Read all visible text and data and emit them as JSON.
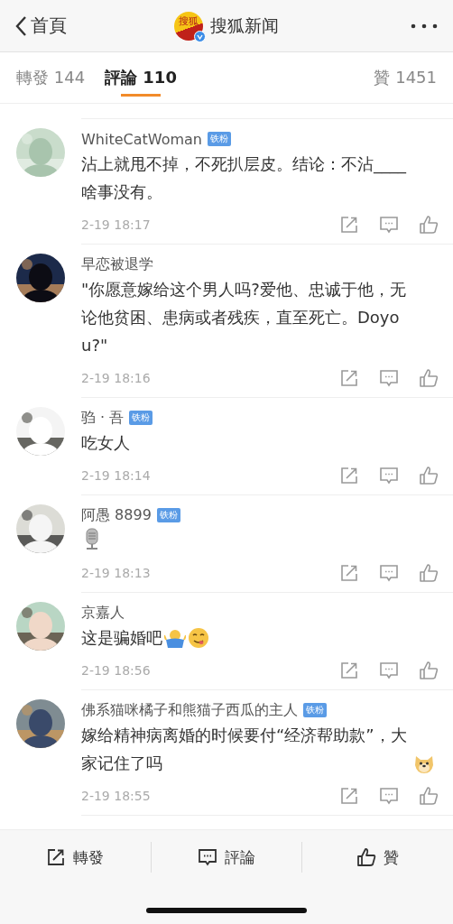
{
  "nav": {
    "back": "首頁",
    "logo_text": "搜狐",
    "verified": true,
    "title": "搜狐新闻"
  },
  "tabs": [
    {
      "label": "轉發 144",
      "selected": false
    },
    {
      "label": "評論 110",
      "selected": true
    },
    {
      "label": "贊 1451",
      "selected": false
    }
  ],
  "comments": [
    {
      "name": "WhiteCatWoman",
      "badge": "铁粉",
      "text": "沾上就甩不掉，不死扒层皮。结论：不沾____啥事没有。",
      "time": "2-19 18:17"
    },
    {
      "name": "早恋被退学",
      "text": "\"你愿意嫁给这个男人吗?爱他、忠诚于他，无论他贫困、患病或者残疾，直至死亡。Doyou?\"",
      "time": "2-19 18:16"
    },
    {
      "name": "驺 · 吾",
      "badge": "铁粉",
      "text": "吃女人",
      "time": "2-19 18:14"
    },
    {
      "name": "阿愚 8899",
      "badge": "铁粉",
      "emojis": [
        {
          "kind": "microphone"
        }
      ],
      "time": "2-19 18:13"
    },
    {
      "name": "京嘉人",
      "text": "这是骗婚吧",
      "emojis": [
        {
          "kind": "shrug"
        },
        {
          "kind": "yum"
        }
      ],
      "time": "2-19 18:56"
    },
    {
      "name": "佛系猫咪橘子和熊猫子西瓜的主人",
      "badge": "铁粉",
      "text": "嫁给精神病离婚的时候要付“经济帮助款”，大家记住了吗",
      "emojis": [
        {
          "kind": "doge"
        }
      ],
      "time": "2-19 18:55"
    }
  ],
  "actions": [
    {
      "kind": "share",
      "label": "轉發"
    },
    {
      "kind": "comment",
      "label": "評論"
    },
    {
      "kind": "like",
      "label": "贊"
    }
  ]
}
